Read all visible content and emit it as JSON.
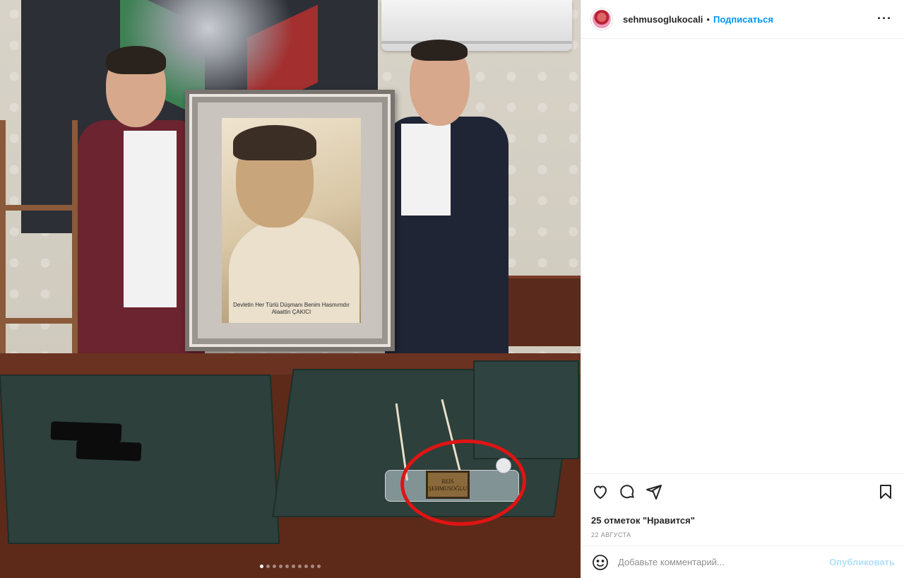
{
  "post": {
    "username": "sehmusoglukocali",
    "separator": "•",
    "follow_label": "Подписаться",
    "more_label": "···",
    "likes_text": "25 отметок \"Нравится\"",
    "date_text": "22 АВГУСТА",
    "icons": [
      "heart-icon",
      "comment-icon",
      "share-icon",
      "bookmark-icon",
      "emoji-icon",
      "more-icon"
    ]
  },
  "photo": {
    "portrait_caption_line1": "Devletin Her Türlü Düşmanı Benim Hasmımdır",
    "portrait_caption_line2": "Alaattin ÇAKICI",
    "nameplate_line1": "REİS",
    "nameplate_line2": "ŞEHMUSOĞLU",
    "carousel": {
      "count": 10,
      "active_index": 0
    }
  },
  "comment": {
    "placeholder": "Добавьте комментарий...",
    "publish_label": "Опубликовать"
  },
  "colors": {
    "accent": "#0095f6",
    "publish_disabled": "#b2dffc",
    "text": "#262626",
    "muted": "#8e8e8e",
    "highlight_circle": "#e01414"
  }
}
